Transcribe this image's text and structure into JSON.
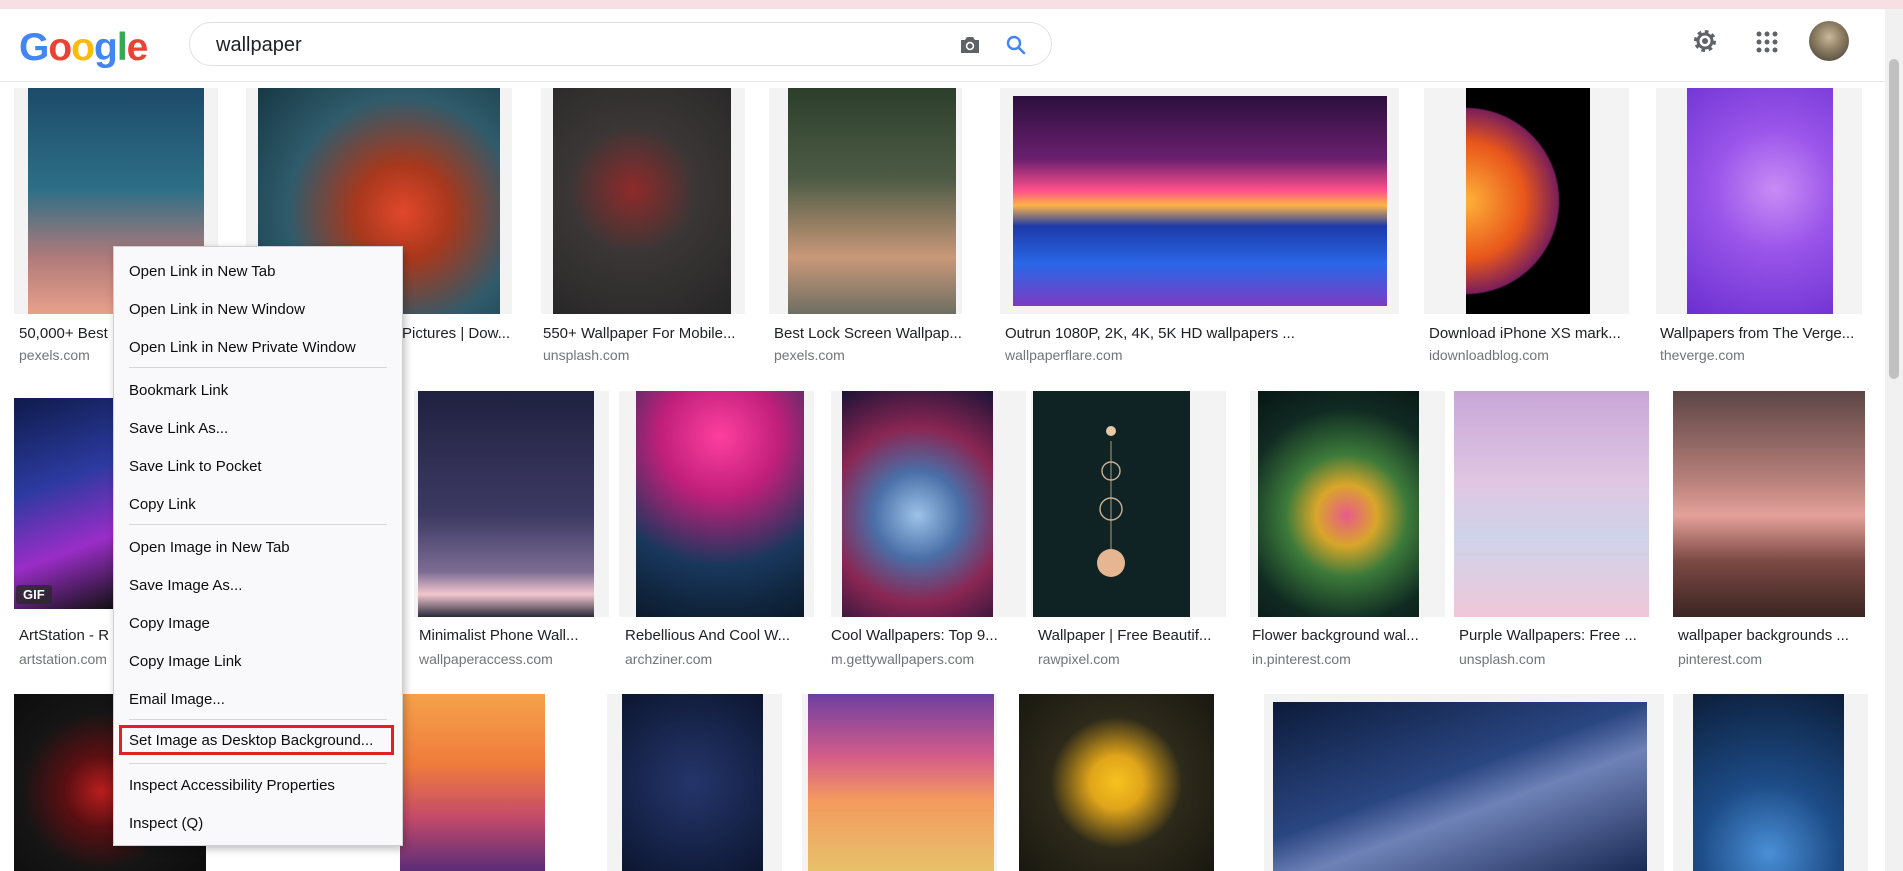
{
  "header": {
    "logo_letters": [
      "G",
      "o",
      "o",
      "g",
      "l",
      "e"
    ],
    "logo_colors": [
      "#4285f4",
      "#ea4335",
      "#fbbc05",
      "#4285f4",
      "#34a853",
      "#ea4335"
    ],
    "search_value": "wallpaper",
    "camera_icon": "camera-icon",
    "search_icon": "search-icon",
    "settings_icon": "gear-icon",
    "apps_icon": "apps-grid-icon",
    "avatar_icon": "avatar"
  },
  "results": {
    "row1": [
      {
        "caption": "50,000+ Best",
        "source": "pexels.com"
      },
      {
        "caption": "Pictures | Dow...",
        "source": ""
      },
      {
        "caption": "550+ Wallpaper For Mobile...",
        "source": "unsplash.com"
      },
      {
        "caption": "Best Lock Screen Wallpap...",
        "source": "pexels.com"
      },
      {
        "caption": "Outrun 1080P, 2K, 4K, 5K HD wallpapers ...",
        "source": "wallpaperflare.com"
      },
      {
        "caption": "Download iPhone XS mark...",
        "source": "idownloadblog.com"
      },
      {
        "caption": "Wallpapers from The Verge...",
        "source": "theverge.com"
      }
    ],
    "row2": [
      {
        "caption": "ArtStation - R",
        "source": "artstation.com"
      },
      {
        "caption": "Minimalist Phone Wall...",
        "source": "wallpaperaccess.com"
      },
      {
        "caption": "Rebellious And Cool W...",
        "source": "archziner.com"
      },
      {
        "caption": "Cool Wallpapers: Top 9...",
        "source": "m.gettywallpapers.com"
      },
      {
        "caption": "Wallpaper | Free Beautif...",
        "source": "rawpixel.com"
      },
      {
        "caption": "Flower background wal...",
        "source": "in.pinterest.com"
      },
      {
        "caption": "Purple Wallpapers: Free ...",
        "source": "unsplash.com"
      },
      {
        "caption": "wallpaper backgrounds ...",
        "source": "pinterest.com"
      }
    ],
    "gif_badge": "GIF"
  },
  "context_menu": {
    "items": [
      "Open Link in New Tab",
      "Open Link in New Window",
      "Open Link in New Private Window",
      "Bookmark Link",
      "Save Link As...",
      "Save Link to Pocket",
      "Copy Link",
      "Open Image in New Tab",
      "Save Image As...",
      "Copy Image",
      "Copy Image Link",
      "Email Image...",
      "Set Image as Desktop Background...",
      "Inspect Accessibility Properties",
      "Inspect (Q)"
    ],
    "highlight_color": "#e31e24"
  }
}
